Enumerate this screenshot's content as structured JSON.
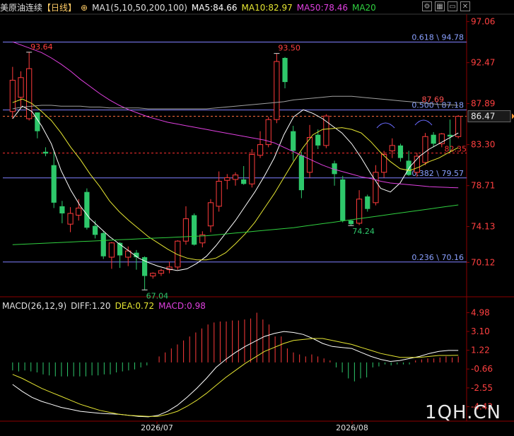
{
  "header": {
    "symbol": "美原油连续",
    "period": "【日线】",
    "ma_group": "MA1(5,10,50,200,100)",
    "ma5": "MA5:84.66",
    "ma10": "MA10:82.97",
    "ma50": "MA50:78.46",
    "ma20": "MA20",
    "icons": [
      "settings-icon",
      "chart-icon",
      "minimize-icon",
      "close-icon"
    ]
  },
  "colors": {
    "up": "#ff3b3b",
    "down": "#2ec86b",
    "ma5": "#ffffff",
    "ma10": "#e6e632",
    "ma50": "#e040e0",
    "ma20": "#30d040",
    "ma200": "#a0a0a0",
    "fib": "#8080ff",
    "axis_price": "#ff5050",
    "axis_text": "#ff4040"
  },
  "chart_data": {
    "type": "candlestick",
    "x_labels": [
      "2026/07",
      "2026/08"
    ],
    "y_ticks": [
      "97.06",
      "92.47",
      "87.89",
      "83.30",
      "78.71",
      "74.13",
      "70.12"
    ],
    "ylim": [
      68.8,
      97.9
    ],
    "current_price": "86.47",
    "series": [
      {
        "name": "MA5",
        "values": [
          86.2,
          87.6,
          87.0,
          85.4,
          83.4,
          80.4,
          78.2,
          76.4,
          75.0,
          74.0,
          73.0,
          72.2,
          71.4,
          70.6,
          70.1,
          69.7,
          69.4,
          69.2,
          69.4,
          70.0,
          70.8,
          72.0,
          73.4,
          74.8,
          76.4,
          78.0,
          79.8,
          81.8,
          84.4,
          86.4,
          87.2,
          86.8,
          86.2,
          85.4,
          84.6,
          83.4,
          81.8,
          80.0,
          78.4,
          78.0,
          79.0,
          80.8,
          82.0,
          82.8,
          83.4,
          84.0,
          84.6
        ]
      },
      {
        "name": "MA10",
        "values": [
          88.0,
          88.4,
          87.9,
          87.0,
          86.0,
          84.6,
          83.0,
          81.6,
          80.0,
          78.6,
          77.0,
          75.8,
          74.8,
          73.9,
          73.0,
          72.3,
          71.6,
          71.0,
          70.6,
          70.4,
          70.4,
          70.6,
          71.2,
          72.2,
          73.3,
          74.6,
          76.2,
          77.8,
          79.6,
          81.4,
          83.0,
          84.4,
          85.0,
          85.1,
          85.2,
          85.0,
          84.6,
          83.6,
          82.4,
          81.4,
          80.6,
          80.4,
          80.8,
          81.4,
          81.8,
          82.4,
          82.97
        ]
      },
      {
        "name": "MA50",
        "values": [
          94.8,
          94.4,
          94.0,
          93.6,
          93.0,
          92.3,
          91.5,
          90.6,
          89.8,
          89.0,
          88.3,
          87.7,
          87.2,
          86.8,
          86.4,
          86.1,
          85.8,
          85.6,
          85.4,
          85.2,
          85.0,
          84.8,
          84.6,
          84.4,
          84.2,
          84.0,
          83.8,
          83.5,
          83.0,
          82.5,
          82.0,
          81.5,
          81.0,
          80.6,
          80.3,
          80.0,
          79.7,
          79.5,
          79.2,
          79.0,
          78.9,
          78.8,
          78.7,
          78.6,
          78.55,
          78.5,
          78.46
        ]
      },
      {
        "name": "MA20",
        "values": [
          72.1,
          72.15,
          72.2,
          72.25,
          72.3,
          72.35,
          72.4,
          72.45,
          72.5,
          72.55,
          72.6,
          72.65,
          72.7,
          72.75,
          72.8,
          72.85,
          72.9,
          72.95,
          73.0,
          73.05,
          73.1,
          73.2,
          73.3,
          73.4,
          73.5,
          73.6,
          73.7,
          73.8,
          73.9,
          74.0,
          74.15,
          74.3,
          74.45,
          74.6,
          74.75,
          74.9,
          75.05,
          75.2,
          75.35,
          75.5,
          75.65,
          75.8,
          75.95,
          76.1,
          76.25,
          76.4,
          76.55
        ]
      },
      {
        "name": "MA200",
        "values": [
          87.3,
          87.5,
          87.6,
          87.7,
          87.7,
          87.6,
          87.6,
          87.6,
          87.5,
          87.5,
          87.4,
          87.4,
          87.4,
          87.4,
          87.3,
          87.3,
          87.3,
          87.3,
          87.3,
          87.3,
          87.3,
          87.4,
          87.5,
          87.6,
          87.7,
          87.8,
          87.9,
          88.0,
          88.1,
          88.3,
          88.4,
          88.5,
          88.6,
          88.7,
          88.7,
          88.7,
          88.6,
          88.5,
          88.4,
          88.3,
          88.2,
          88.1,
          88.0,
          87.9,
          87.8,
          87.75,
          87.7
        ]
      }
    ],
    "candles": [
      {
        "o": 87.0,
        "h": 92.0,
        "l": 86.2,
        "c": 90.5
      },
      {
        "o": 88.6,
        "h": 91.5,
        "l": 87.5,
        "c": 90.8
      },
      {
        "o": 86.2,
        "h": 93.64,
        "l": 86.0,
        "c": 91.8
      },
      {
        "o": 86.9,
        "h": 86.9,
        "l": 84.0,
        "c": 84.8
      },
      {
        "o": 82.5,
        "h": 83.0,
        "l": 82.0,
        "c": 82.3
      },
      {
        "o": 81.0,
        "h": 82.5,
        "l": 76.2,
        "c": 76.8
      },
      {
        "o": 76.4,
        "h": 77.0,
        "l": 74.5,
        "c": 75.6
      },
      {
        "o": 74.4,
        "h": 76.3,
        "l": 73.5,
        "c": 75.6
      },
      {
        "o": 75.4,
        "h": 77.2,
        "l": 74.8,
        "c": 76.2
      },
      {
        "o": 78.0,
        "h": 78.4,
        "l": 73.8,
        "c": 74.0
      },
      {
        "o": 74.2,
        "h": 74.8,
        "l": 72.8,
        "c": 73.2
      },
      {
        "o": 73.4,
        "h": 73.6,
        "l": 70.5,
        "c": 70.8
      },
      {
        "o": 70.7,
        "h": 72.4,
        "l": 69.4,
        "c": 72.3
      },
      {
        "o": 72.3,
        "h": 72.4,
        "l": 69.5,
        "c": 70.9
      },
      {
        "o": 70.7,
        "h": 71.9,
        "l": 69.7,
        "c": 71.4
      },
      {
        "o": 71.2,
        "h": 71.5,
        "l": 69.3,
        "c": 70.7
      },
      {
        "o": 70.7,
        "h": 70.8,
        "l": 67.04,
        "c": 68.6
      },
      {
        "o": 68.6,
        "h": 69.0,
        "l": 68.3,
        "c": 68.9
      },
      {
        "o": 68.9,
        "h": 69.4,
        "l": 68.6,
        "c": 69.2
      },
      {
        "o": 69.3,
        "h": 70.2,
        "l": 68.9,
        "c": 69.6
      },
      {
        "o": 69.6,
        "h": 72.6,
        "l": 69.3,
        "c": 72.5
      },
      {
        "o": 72.5,
        "h": 76.4,
        "l": 72.1,
        "c": 75.0
      },
      {
        "o": 75.4,
        "h": 75.6,
        "l": 72.0,
        "c": 72.1
      },
      {
        "o": 72.3,
        "h": 73.6,
        "l": 71.8,
        "c": 73.2
      },
      {
        "o": 74.2,
        "h": 77.2,
        "l": 73.5,
        "c": 76.8
      },
      {
        "o": 76.4,
        "h": 80.3,
        "l": 75.8,
        "c": 79.2
      },
      {
        "o": 79.3,
        "h": 80.0,
        "l": 78.3,
        "c": 79.6
      },
      {
        "o": 79.4,
        "h": 80.2,
        "l": 78.7,
        "c": 79.9
      },
      {
        "o": 79.4,
        "h": 80.9,
        "l": 78.8,
        "c": 78.9
      },
      {
        "o": 78.9,
        "h": 82.8,
        "l": 78.5,
        "c": 82.2
      },
      {
        "o": 82.1,
        "h": 84.8,
        "l": 81.8,
        "c": 83.3
      },
      {
        "o": 83.3,
        "h": 86.4,
        "l": 83.0,
        "c": 86.1
      },
      {
        "o": 86.1,
        "h": 93.5,
        "l": 85.7,
        "c": 92.6
      },
      {
        "o": 93.0,
        "h": 93.1,
        "l": 89.6,
        "c": 90.3
      },
      {
        "o": 84.8,
        "h": 85.4,
        "l": 81.5,
        "c": 82.6
      },
      {
        "o": 82.1,
        "h": 82.5,
        "l": 77.3,
        "c": 78.2
      },
      {
        "o": 80.2,
        "h": 85.5,
        "l": 79.6,
        "c": 84.1
      },
      {
        "o": 84.4,
        "h": 85.0,
        "l": 82.8,
        "c": 83.2
      },
      {
        "o": 83.2,
        "h": 86.7,
        "l": 82.9,
        "c": 86.5
      },
      {
        "o": 81.2,
        "h": 81.5,
        "l": 78.7,
        "c": 80.0
      },
      {
        "o": 79.4,
        "h": 79.8,
        "l": 74.6,
        "c": 74.8
      },
      {
        "o": 74.8,
        "h": 74.9,
        "l": 74.24,
        "c": 74.4
      },
      {
        "o": 74.5,
        "h": 78.2,
        "l": 74.3,
        "c": 77.2
      },
      {
        "o": 77.5,
        "h": 77.7,
        "l": 75.8,
        "c": 76.1
      },
      {
        "o": 76.8,
        "h": 81.0,
        "l": 76.5,
        "c": 80.2
      },
      {
        "o": 80.2,
        "h": 82.6,
        "l": 79.6,
        "c": 82.2
      },
      {
        "o": 82.6,
        "h": 84.0,
        "l": 81.8,
        "c": 83.2
      },
      {
        "o": 83.2,
        "h": 83.4,
        "l": 81.4,
        "c": 81.8
      },
      {
        "o": 81.5,
        "h": 82.6,
        "l": 79.8,
        "c": 79.9
      },
      {
        "o": 80.2,
        "h": 82.4,
        "l": 79.7,
        "c": 82.0
      },
      {
        "o": 81.3,
        "h": 84.6,
        "l": 81.0,
        "c": 84.2
      },
      {
        "o": 84.4,
        "h": 84.7,
        "l": 83.0,
        "c": 83.4
      },
      {
        "o": 83.4,
        "h": 84.6,
        "l": 83.0,
        "c": 84.5
      },
      {
        "o": 84.4,
        "h": 86.1,
        "l": 82.4,
        "c": 84.2
      },
      {
        "o": 84.2,
        "h": 86.6,
        "l": 84.0,
        "c": 86.47
      }
    ],
    "fib_levels": [
      {
        "label": "0.618 \\ 94.78",
        "value": 94.78
      },
      {
        "label": "0.500 \\ 87.18",
        "value": 87.18
      },
      {
        "label": "0.382 \\ 79.57",
        "value": 79.57
      },
      {
        "label": "0.236 \\ 70.16",
        "value": 70.16
      }
    ],
    "hlines": [
      {
        "label": "87.69",
        "value": 86.47,
        "color": "#ff6a3c",
        "style": "dashed"
      },
      {
        "label": "82.35",
        "value": 82.35,
        "color": "#ff3030",
        "style": "dashed"
      }
    ],
    "annotations": [
      {
        "text": "93.64",
        "index": 2,
        "value": 93.64,
        "pos": "above",
        "color": "#ff4040"
      },
      {
        "text": "67.04",
        "index": 16,
        "value": 67.04,
        "pos": "below",
        "color": "#2ec86b"
      },
      {
        "text": "93.50",
        "index": 32,
        "value": 93.5,
        "pos": "above",
        "color": "#ff4040"
      },
      {
        "text": "74.24",
        "index": 41,
        "value": 74.24,
        "pos": "below",
        "color": "#2ec86b"
      }
    ],
    "macd": {
      "label": "MACD(26,12,9)",
      "diff_label": "DIFF:1.20",
      "dea_label": "DEA:0.72",
      "macd_label": "MACD:0.98",
      "y_ticks": [
        "4.98",
        "3.10",
        "1.22",
        "-0.66",
        "-2.55",
        "-4.43"
      ],
      "ylim": [
        -5.6,
        5.3
      ],
      "hist": [
        -0.8,
        -0.9,
        -0.8,
        -0.9,
        -1.0,
        -1.2,
        -1.3,
        -1.4,
        -1.4,
        -1.4,
        -1.4,
        -1.4,
        -1.4,
        -1.3,
        -1.3,
        -1.2,
        -1.2,
        -1.0,
        -0.9,
        -0.8,
        -0.7,
        -0.5,
        -0.3,
        0.0,
        0.6,
        1.0,
        1.4,
        1.8,
        2.2,
        2.6,
        3.0,
        3.4,
        3.8,
        4.0,
        4.1,
        4.1,
        4.2,
        4.2,
        4.3,
        4.4,
        4.98,
        4.3,
        3.8,
        2.6,
        2.6,
        1.4,
        1.0,
        0.8,
        0.6,
        0.8,
        0.6,
        0.4,
        0.2,
        -0.5,
        -1.0,
        -1.6,
        -1.9,
        -1.6,
        -1.5,
        -0.5,
        -0.4,
        -0.2,
        -0.3,
        -0.2,
        -0.2,
        -0.2,
        0.2,
        0.3,
        0.4,
        0.4,
        0.5,
        0.6,
        0.5,
        0.6
      ],
      "diff": [
        -2.2,
        -2.9,
        -3.5,
        -3.9,
        -4.2,
        -4.5,
        -4.7,
        -4.9,
        -5.0,
        -5.1,
        -5.15,
        -5.2,
        -5.3,
        -5.4,
        -5.45,
        -5.3,
        -4.9,
        -4.3,
        -3.5,
        -2.6,
        -1.6,
        -0.5,
        0.3,
        1.0,
        1.6,
        2.1,
        2.6,
        2.9,
        3.1,
        3.0,
        2.8,
        2.4,
        1.9,
        1.6,
        1.5,
        1.4,
        1.0,
        0.6,
        0.3,
        0.1,
        0.2,
        0.4,
        0.6,
        0.9,
        1.1,
        1.2,
        1.2
      ],
      "dea": [
        -1.2,
        -1.6,
        -2.1,
        -2.6,
        -3.0,
        -3.4,
        -3.8,
        -4.2,
        -4.5,
        -4.8,
        -5.0,
        -5.2,
        -5.3,
        -5.35,
        -5.4,
        -5.4,
        -5.2,
        -4.9,
        -4.4,
        -3.8,
        -3.1,
        -2.3,
        -1.5,
        -0.8,
        -0.1,
        0.5,
        1.1,
        1.5,
        1.9,
        2.2,
        2.3,
        2.4,
        2.4,
        2.2,
        2.0,
        1.8,
        1.5,
        1.2,
        0.9,
        0.7,
        0.5,
        0.5,
        0.5,
        0.6,
        0.7,
        0.7,
        0.72
      ]
    }
  },
  "watermark": "1QH.CN"
}
